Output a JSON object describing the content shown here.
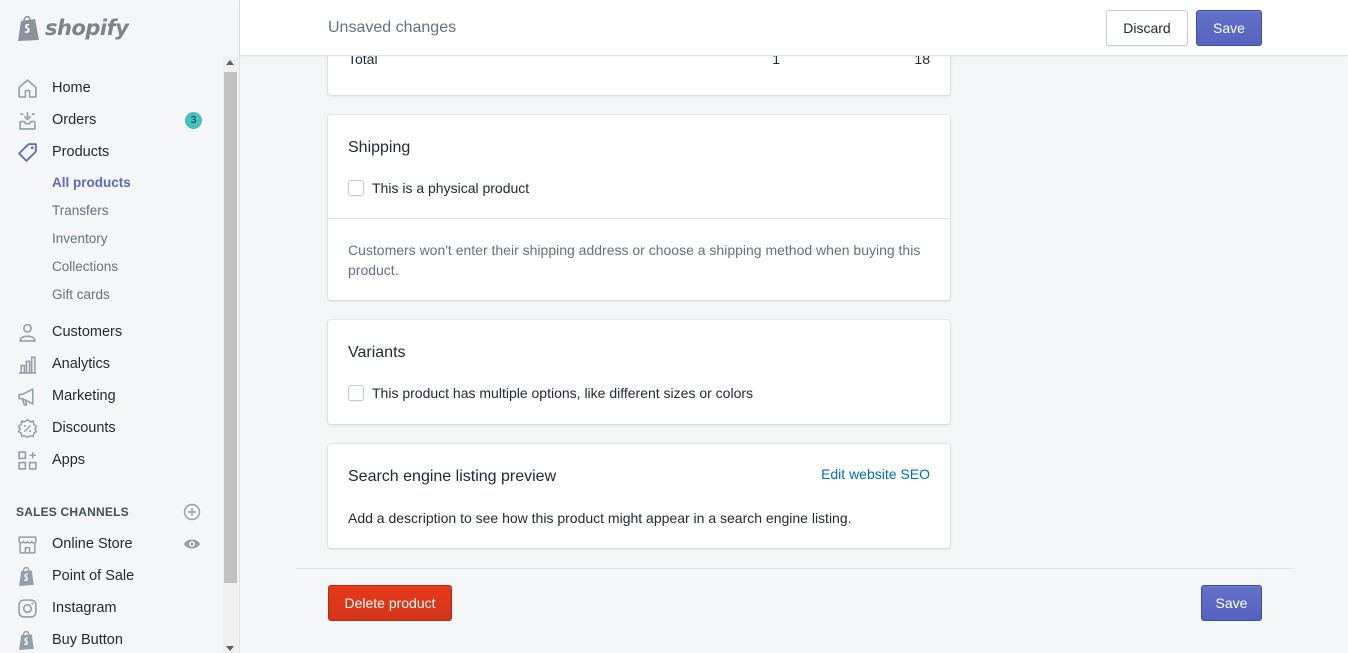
{
  "brand": {
    "name": "shopify"
  },
  "topbar": {
    "title": "Unsaved changes",
    "discard_label": "Discard",
    "save_label": "Save"
  },
  "sidebar": {
    "items": [
      {
        "label": "Home",
        "icon": "home-icon"
      },
      {
        "label": "Orders",
        "icon": "orders-icon",
        "badge": "3"
      },
      {
        "label": "Products",
        "icon": "tag-icon"
      }
    ],
    "product_subitems": [
      {
        "label": "All products",
        "active": true
      },
      {
        "label": "Transfers"
      },
      {
        "label": "Inventory"
      },
      {
        "label": "Collections"
      },
      {
        "label": "Gift cards"
      }
    ],
    "items2": [
      {
        "label": "Customers",
        "icon": "customers-icon"
      },
      {
        "label": "Analytics",
        "icon": "analytics-icon"
      },
      {
        "label": "Marketing",
        "icon": "megaphone-icon"
      },
      {
        "label": "Discounts",
        "icon": "discount-icon"
      },
      {
        "label": "Apps",
        "icon": "apps-icon"
      }
    ],
    "sales_channels_heading": "SALES CHANNELS",
    "channels": [
      {
        "label": "Online Store",
        "icon": "store-icon"
      },
      {
        "label": "Point of Sale",
        "icon": "shopify-bag-icon"
      },
      {
        "label": "Instagram",
        "icon": "instagram-icon"
      },
      {
        "label": "Buy Button",
        "icon": "shopify-bag-icon"
      }
    ]
  },
  "inventory_total": {
    "label": "Total",
    "quantity": "1",
    "value": "18"
  },
  "shipping": {
    "title": "Shipping",
    "checkbox_label": "This is a physical product",
    "checked": false,
    "help_text": "Customers won't enter their shipping address or choose a shipping method when buying this product."
  },
  "variants": {
    "title": "Variants",
    "checkbox_label": "This product has multiple options, like different sizes or colors",
    "checked": false
  },
  "seo": {
    "title": "Search engine listing preview",
    "edit_link": "Edit website SEO",
    "description": "Add a description to see how this product might appear in a search engine listing."
  },
  "footer": {
    "delete_label": "Delete product",
    "save_label": "Save"
  },
  "colors": {
    "primary": "#5c6ac4",
    "destructive": "#de3618",
    "link": "#006fbb",
    "badge": "#47c1bf"
  }
}
